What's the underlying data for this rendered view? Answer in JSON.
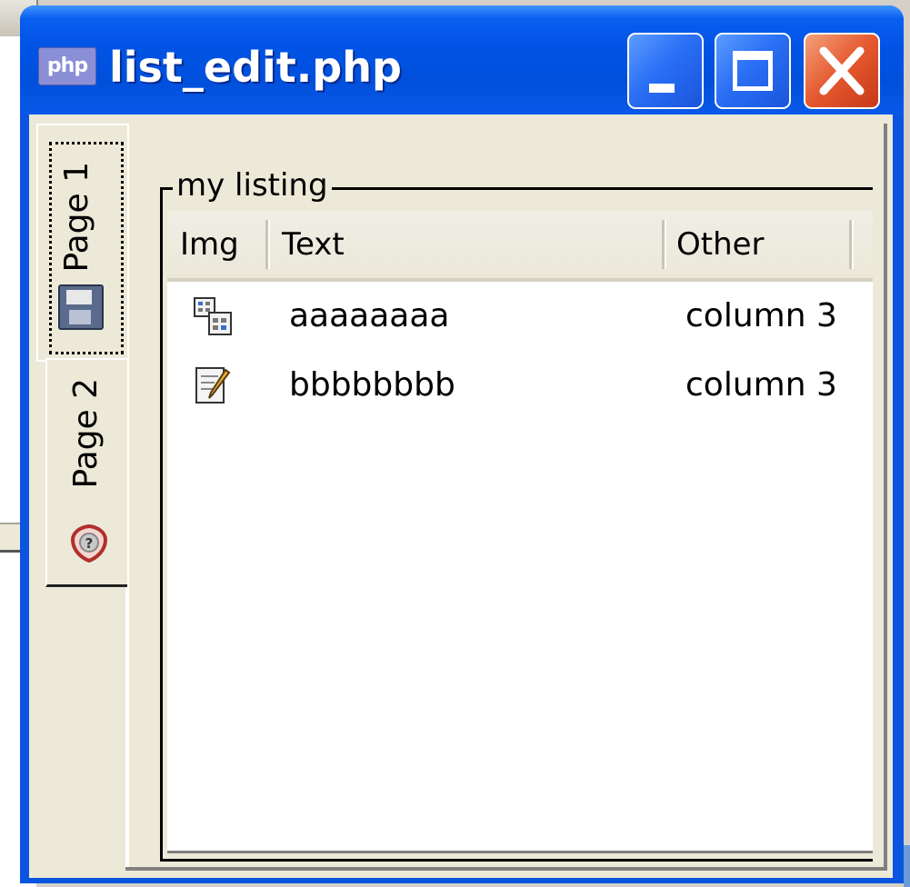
{
  "window": {
    "app_icon_text": "php",
    "title": "list_edit.php"
  },
  "tabs": [
    {
      "label": "Page 1",
      "icon": "floppy-disk-icon",
      "selected": true
    },
    {
      "label": "Page 2",
      "icon": "help-shield-icon",
      "selected": false
    }
  ],
  "group": {
    "legend": "my listing"
  },
  "listview": {
    "columns": [
      "Img",
      "Text",
      "Other"
    ],
    "rows": [
      {
        "icon": "windows-tiles-icon",
        "text": "aaaaaaaa",
        "other": "column 3"
      },
      {
        "icon": "notepad-pencil-icon",
        "text": "bbbbbbbb",
        "other": "column 3"
      }
    ]
  },
  "colors": {
    "titlebar": "#0053e4",
    "close_button": "#e5582e",
    "client_bg": "#ece9d8"
  }
}
